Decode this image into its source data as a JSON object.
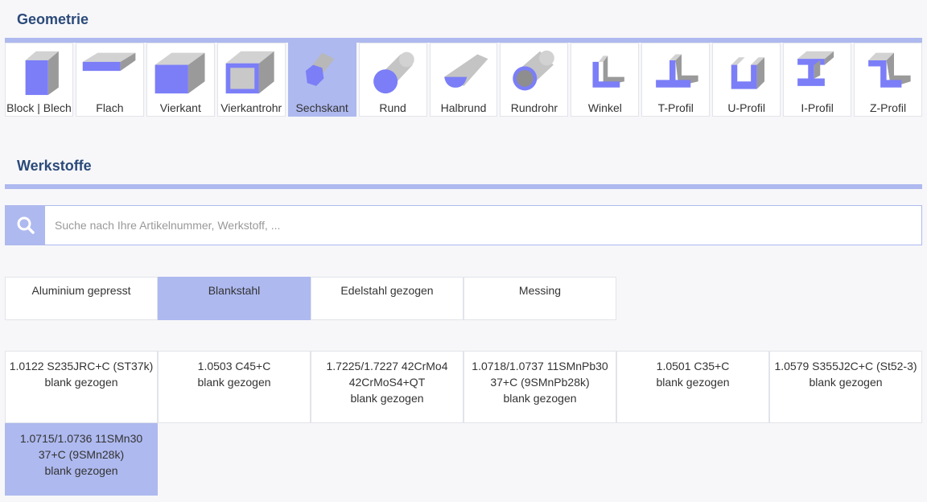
{
  "geometry": {
    "title": "Geometrie",
    "active_index": 4,
    "accent_color": "#aeb9ef",
    "shape_color": "#7b7ef7",
    "items": [
      {
        "label": "Block | Blech",
        "icon": "block-icon"
      },
      {
        "label": "Flach",
        "icon": "flat-bar-icon"
      },
      {
        "label": "Vierkant",
        "icon": "square-bar-icon"
      },
      {
        "label": "Vierkantrohr",
        "icon": "square-tube-icon"
      },
      {
        "label": "Sechskant",
        "icon": "hexagon-bar-icon"
      },
      {
        "label": "Rund",
        "icon": "round-bar-icon"
      },
      {
        "label": "Halbrund",
        "icon": "half-round-bar-icon"
      },
      {
        "label": "Rundrohr",
        "icon": "round-tube-icon"
      },
      {
        "label": "Winkel",
        "icon": "angle-profile-icon"
      },
      {
        "label": "T-Profil",
        "icon": "t-profile-icon"
      },
      {
        "label": "U-Profil",
        "icon": "u-profile-icon"
      },
      {
        "label": "I-Profil",
        "icon": "i-profile-icon"
      },
      {
        "label": "Z-Profil",
        "icon": "z-profile-icon"
      }
    ]
  },
  "materials": {
    "title": "Werkstoffe",
    "search": {
      "placeholder": "Suche nach Ihre Artikelnummer, Werkstoff, ...",
      "value": "",
      "icon": "search-icon"
    },
    "categories": [
      {
        "label": "Aluminium gepresst",
        "active": false
      },
      {
        "label": "Blankstahl",
        "active": true
      },
      {
        "label": "Edelstahl gezogen",
        "active": false
      },
      {
        "label": "Messing",
        "active": false
      }
    ],
    "items": [
      {
        "lines": [
          "1.0122 S235JRC+C (ST37k)",
          "blank gezogen"
        ],
        "active": false
      },
      {
        "lines": [
          "1.0503 C45+C",
          "blank gezogen"
        ],
        "active": false
      },
      {
        "lines": [
          "1.7225/1.7227 42CrMo4",
          "42CrMoS4+QT",
          "blank gezogen"
        ],
        "active": false
      },
      {
        "lines": [
          "1.0718/1.0737 11SMnPb30",
          "37+C (9SMnPb28k)",
          "blank gezogen"
        ],
        "active": false
      },
      {
        "lines": [
          "1.0501 C35+C",
          "blank gezogen"
        ],
        "active": false
      },
      {
        "lines": [
          "1.0579 S355J2C+C (St52-3)",
          "blank gezogen"
        ],
        "active": false
      },
      {
        "lines": [
          "1.0715/1.0736 11SMn30",
          "37+C (9SMn28k)",
          "blank gezogen"
        ],
        "active": true
      }
    ]
  }
}
